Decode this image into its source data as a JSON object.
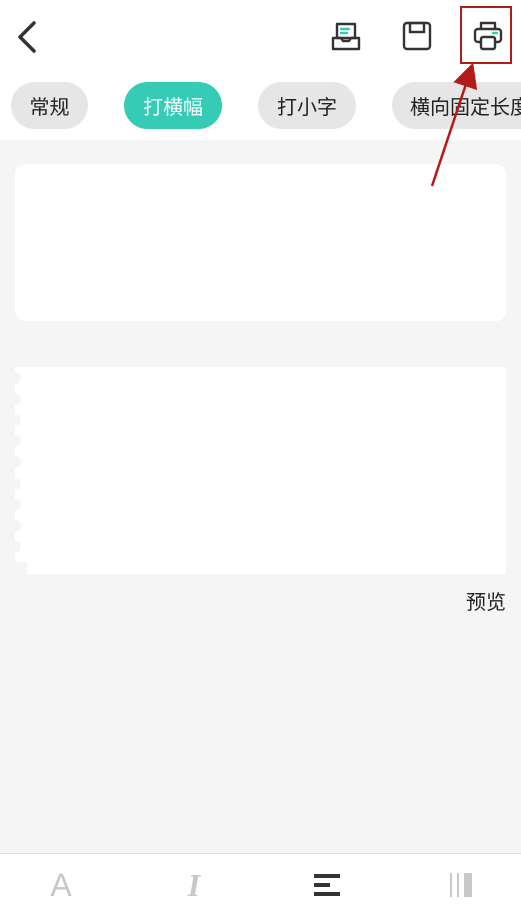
{
  "header": {
    "back_icon": "chevron-left-icon",
    "actions": [
      {
        "icon": "inbox-tray-icon"
      },
      {
        "icon": "save-disk-icon"
      },
      {
        "icon": "printer-icon"
      }
    ]
  },
  "tabs": [
    {
      "label": "常规",
      "active": false
    },
    {
      "label": "打横幅",
      "active": true
    },
    {
      "label": "打小字",
      "active": false
    },
    {
      "label": "横向固定长度",
      "active": false
    }
  ],
  "preview": {
    "label": "预览"
  },
  "bottom_toolbar": {
    "bold_label": "A",
    "italic_label": "I"
  },
  "colors": {
    "accent": "#35cbb4",
    "annotation": "#b31b1b"
  }
}
